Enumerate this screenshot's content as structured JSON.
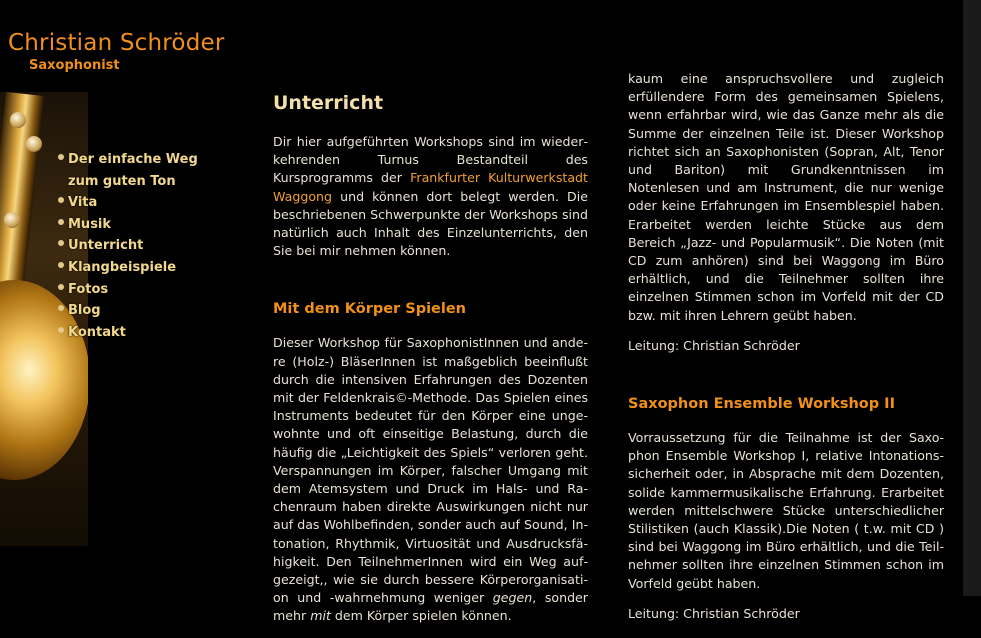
{
  "header": {
    "title": "Christian Schröder",
    "subtitle": "Saxophonist"
  },
  "nav": [
    {
      "label": "Der einfache Weg zum guten Ton"
    },
    {
      "label": "Vita"
    },
    {
      "label": "Musik"
    },
    {
      "label": "Unterricht"
    },
    {
      "label": "Klangbeispiele"
    },
    {
      "label": "Fotos"
    },
    {
      "label": "Blog"
    },
    {
      "label": "Kontakt"
    }
  ],
  "content": {
    "heading": "Unterricht",
    "intro": {
      "before": "Dir hier aufgeführten Workshops sind im wieder­kehrenden Turnus Bestandteil des Kursprogramms der ",
      "link": "Frankfurter Kulturwerkstadt Waggong",
      "after": " und können dort belegt werden. Die beschriebenen Schwerpunkte der Workshops sind natürlich auch Inhalt des Einzelunterrichts, den Sie bei mir neh­men können."
    },
    "section1": {
      "title": "Mit dem Körper Spielen",
      "text_a": "Dieser Workshop für SaxophonistInnen und ande­re (Holz-) BläserInnen ist maßgeblich beeinflußt durch die intensiven Erfahrungen des Dozenten mit der Feldenkrais©-Methode. Das Spielen eines Instruments bedeutet für den Körper eine unge­wohnte und oft einseitige Belastung, durch die häufig die „Leichtigkeit des Spiels“ verloren geht. Verspannungen im Körper, falscher Umgang mit dem Atemsystem und Druck im Hals- und Ra­chenraum haben direkte Auswirkungen nicht nur auf das Wohlbefinden, sonder auch auf Sound, In­tonation, Rhythmik, Virtuosität und Ausdrucksfä­higkeit. Den TeilnehmerInnen wird ein Weg auf­gezeigt,, wie sie durch bessere Körperorganisati­on und -wahrnehmung weniger ",
      "em_a": "gegen",
      "text_b": ", sonder mehr ",
      "em_b": "mit",
      "text_c": " dem Körper spielen können."
    },
    "col2_text": "kaum eine anspruchsvollere und zugleich erfüllen­dere Form des gemeinsamen Spielens, wenn er­fahrbar wird, wie das Ganze mehr als die Summe der einzelnen Teile ist. Dieser Workshop richtet sich an Saxophonisten (Sopran, Alt, Tenor und Bariton) mit Grundkenntnissen im Notenlesen und am Instrument, die nur wenige oder keine Erfahrungen im Ensemblespiel haben. Erarbeitet werden leichte Stücke aus dem Bereich „Jazz- und Popularmusik“. Die Noten (mit CD zum anhö­ren) sind bei Waggong im Büro erhältlich, und die Teilnehmer sollten ihre einzelnen Stimmen schon im Vorfeld mit der CD bzw. mit ihren Lehrern ge­übt haben.",
    "leitung1": "Leitung: Christian Schröder",
    "section2": {
      "title": "Saxophon Ensemble Workshop II",
      "text": "Vorraussetzung für die Teilnahme ist der Saxo­phon Ensemble Workshop I, relative Intonations­sicherheit oder, in Absprache mit dem Dozenten, solide kammermusikalische Erfahrung. Erarbeitet werden mittelschwere Stücke unterschiedlicher Stilistiken (auch Klassik).Die Noten ( t.w. mit CD ) sind bei Waggong im Büro erhältlich, und die Teil­nehmer sollten ihre einzelnen Stimmen schon im Vorfeld geübt haben.",
      "leitung": "Leitung: Christian Schröder"
    }
  },
  "colors": {
    "accent": "#f0901a",
    "nav": "#f2d88c",
    "background": "#000000"
  }
}
